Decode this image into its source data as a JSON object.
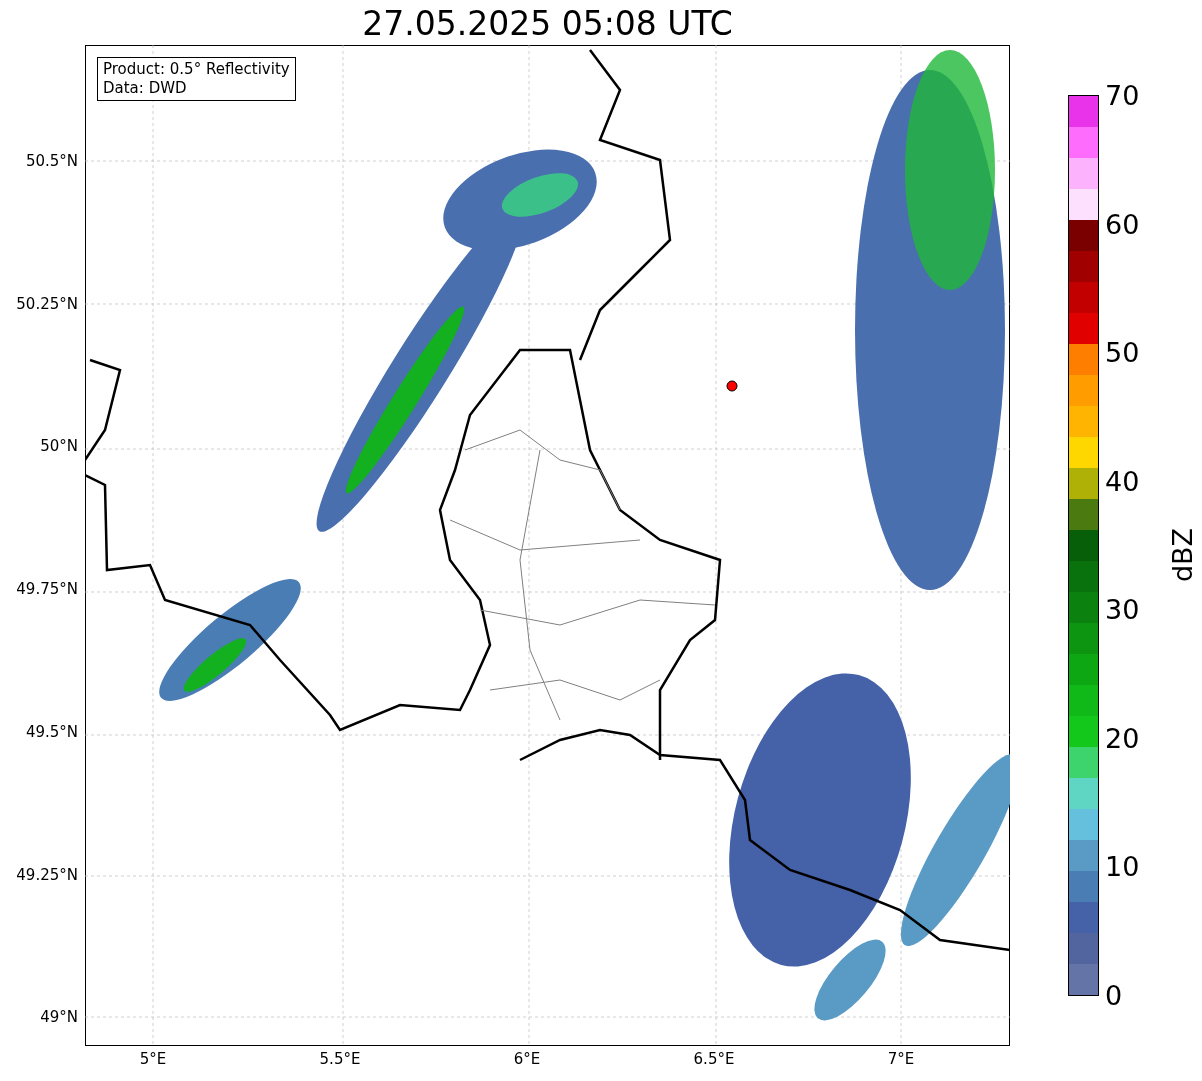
{
  "title": "27.05.2025 05:08 UTC",
  "info_box": {
    "lines": [
      "Product: 0.5° Reflectivity",
      "Data: DWD"
    ]
  },
  "y_tick_labels": [
    "50.5°N",
    "50.25°N",
    "50°N",
    "49.75°N",
    "49.5°N",
    "49.25°N",
    "49°N"
  ],
  "x_tick_labels": [
    "5°E",
    "5.5°E",
    "6°E",
    "6.5°E",
    "7°E"
  ],
  "colorbar": {
    "label": "dBZ",
    "tick_labels": [
      "70",
      "60",
      "50",
      "40",
      "30",
      "20",
      "10",
      "0"
    ],
    "bins": [
      {
        "color": "#e933ea"
      },
      {
        "color": "#fd6cfd"
      },
      {
        "color": "#fdb2fd"
      },
      {
        "color": "#fde0fd"
      },
      {
        "color": "#7a0000"
      },
      {
        "color": "#a00000"
      },
      {
        "color": "#c20000"
      },
      {
        "color": "#e00000"
      },
      {
        "color": "#fe7f00"
      },
      {
        "color": "#fe9c00"
      },
      {
        "color": "#feb400"
      },
      {
        "color": "#fed600"
      },
      {
        "color": "#afb107"
      },
      {
        "color": "#4a7a10"
      },
      {
        "color": "#085f0a"
      },
      {
        "color": "#0a720c"
      },
      {
        "color": "#0b820f"
      },
      {
        "color": "#0d9410"
      },
      {
        "color": "#0ea714"
      },
      {
        "color": "#10b918"
      },
      {
        "color": "#13c81b"
      },
      {
        "color": "#3dd46e"
      },
      {
        "color": "#5fd6c3"
      },
      {
        "color": "#64c0dc"
      },
      {
        "color": "#5a9bc6"
      },
      {
        "color": "#4a7db4"
      },
      {
        "color": "#4561a8"
      },
      {
        "color": "#52659f"
      },
      {
        "color": "#6474a6"
      }
    ]
  }
}
